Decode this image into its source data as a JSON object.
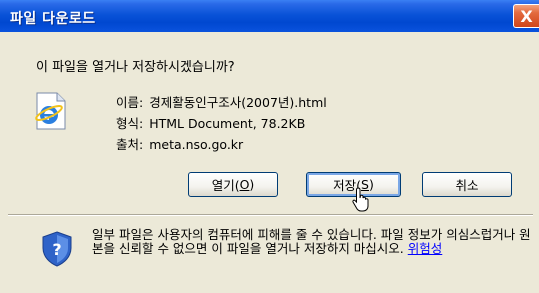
{
  "window": {
    "title": "파일 다운로드",
    "close_label": "X"
  },
  "dialog": {
    "question": "이 파일을 열거나 저장하시겠습니까?",
    "file_icon": "ie-document-icon",
    "name_label": "이름:",
    "name_value": "경제활동인구조사(2007년).html",
    "type_label": "형식:",
    "type_value": "HTML Document, 78.2KB",
    "from_label": "출처:",
    "from_value": "meta.nso.go.kr",
    "buttons": {
      "open_prefix": "열기(",
      "open_key": "O",
      "open_suffix": ")",
      "save_prefix": "저장(",
      "save_key": "S",
      "save_suffix": ")",
      "cancel": "취소"
    },
    "warning_icon": "security-shield-icon",
    "warning_text": "일부 파일은 사용자의 컴퓨터에 피해를 줄 수 있습니다. 파일 정보가 의심스럽거나 원본을 신뢰할 수 없으면 이 파일을 열거나 저장하지 마십시오. ",
    "risk_link": "위험성"
  },
  "colors": {
    "titlebar": "#0a53d8",
    "close": "#d1451a",
    "dialog_bg": "#ece9d8",
    "link": "#0000ff"
  }
}
